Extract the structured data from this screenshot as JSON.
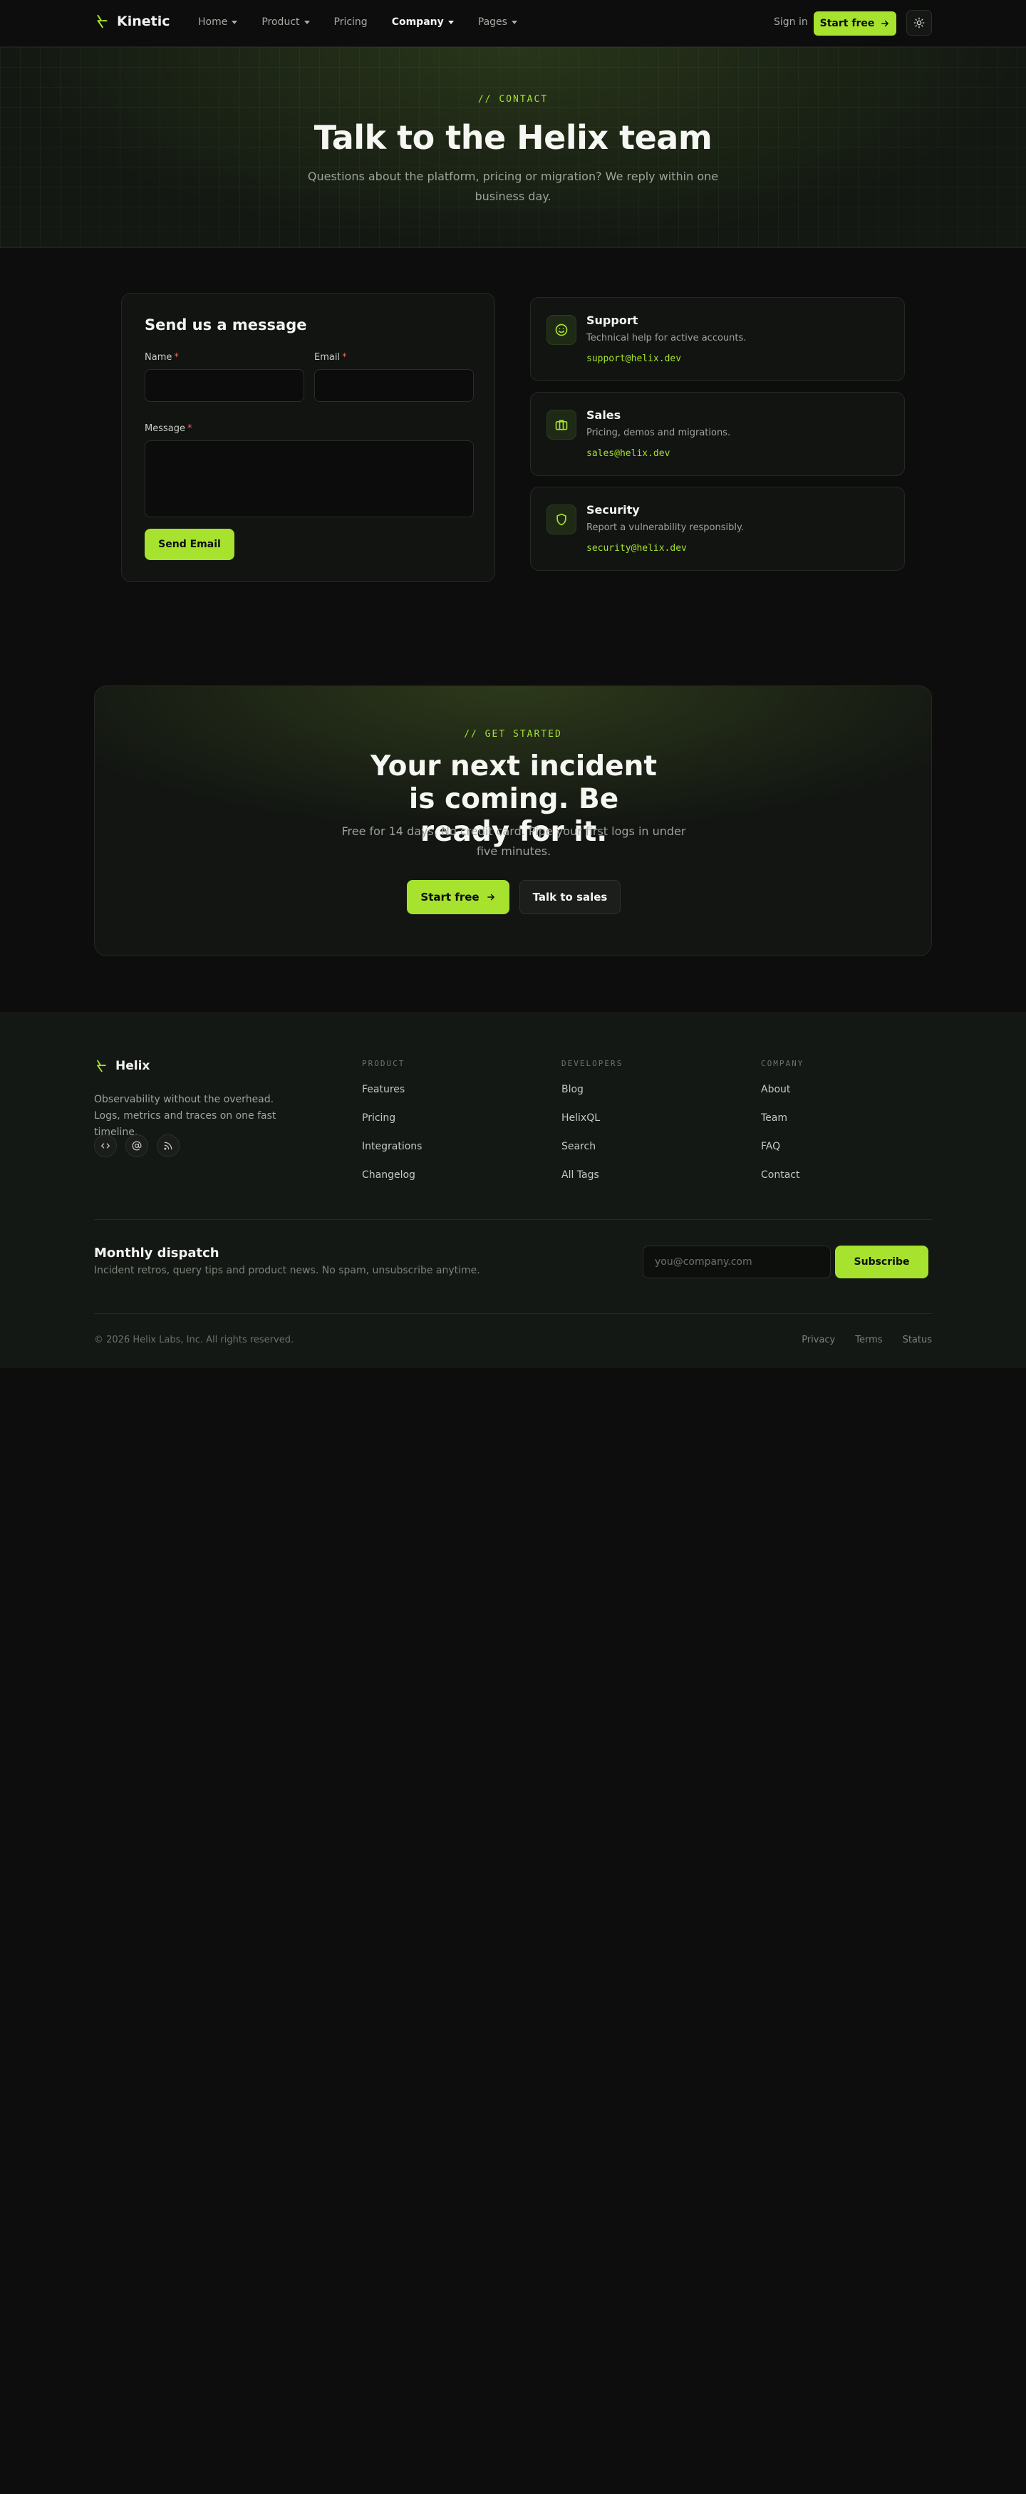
{
  "nav": {
    "brand": "Kinetic",
    "links": [
      {
        "label": "Home",
        "dropdown": true
      },
      {
        "label": "Product",
        "dropdown": true
      },
      {
        "label": "Pricing",
        "dropdown": false
      },
      {
        "label": "Company",
        "dropdown": true,
        "active": true
      },
      {
        "label": "Pages",
        "dropdown": true
      }
    ],
    "sign_in": "Sign in",
    "start_free": "Start free"
  },
  "hero": {
    "eyebrow": "// CONTACT",
    "title": "Talk to the Helix team",
    "subtitle": "Questions about the platform, pricing or migration? We reply within one business day."
  },
  "form": {
    "title": "Send us a message",
    "name_label": "Name",
    "email_label": "Email",
    "message_label": "Message",
    "required_mark": "*",
    "name_value": "",
    "email_value": "",
    "message_value": "",
    "submit": "Send Email"
  },
  "contacts": [
    {
      "title": "Support",
      "desc": "Technical help for active accounts.",
      "email": "support@helix.dev",
      "icon": "smile-icon"
    },
    {
      "title": "Sales",
      "desc": "Pricing, demos and migrations.",
      "email": "sales@helix.dev",
      "icon": "briefcase-icon"
    },
    {
      "title": "Security",
      "desc": "Report a vulnerability responsibly.",
      "email": "security@helix.dev",
      "icon": "shield-icon"
    }
  ],
  "cta": {
    "eyebrow": "// GET STARTED",
    "title": "Your next incident is coming. Be ready for it.",
    "subtitle": "Free for 14 days. No credit card. Pipe your first logs in under five minutes.",
    "primary": "Start free",
    "secondary": "Talk to sales"
  },
  "footer": {
    "brand": "Helix",
    "tagline": "Observability without the overhead. Logs, metrics and traces on one fast timeline.",
    "social": [
      "code-icon",
      "at-icon",
      "rss-icon"
    ],
    "columns": [
      {
        "heading": "PRODUCT",
        "items": [
          "Features",
          "Pricing",
          "Integrations",
          "Changelog"
        ]
      },
      {
        "heading": "DEVELOPERS",
        "items": [
          "Blog",
          "HelixQL",
          "Search",
          "All Tags"
        ]
      },
      {
        "heading": "COMPANY",
        "items": [
          "About",
          "Team",
          "FAQ",
          "Contact"
        ]
      }
    ],
    "newsletter": {
      "title": "Monthly dispatch",
      "desc": "Incident retros, query tips and product news. No spam, unsubscribe anytime.",
      "placeholder": "you@company.com",
      "button": "Subscribe"
    },
    "copyright": "© 2026 Helix Labs, Inc. All rights reserved.",
    "legal": [
      "Privacy",
      "Terms",
      "Status"
    ]
  },
  "colors": {
    "accent": "#a6e22e",
    "background": "#0c0d0c",
    "surface": "#121412",
    "footer": "#141814"
  }
}
